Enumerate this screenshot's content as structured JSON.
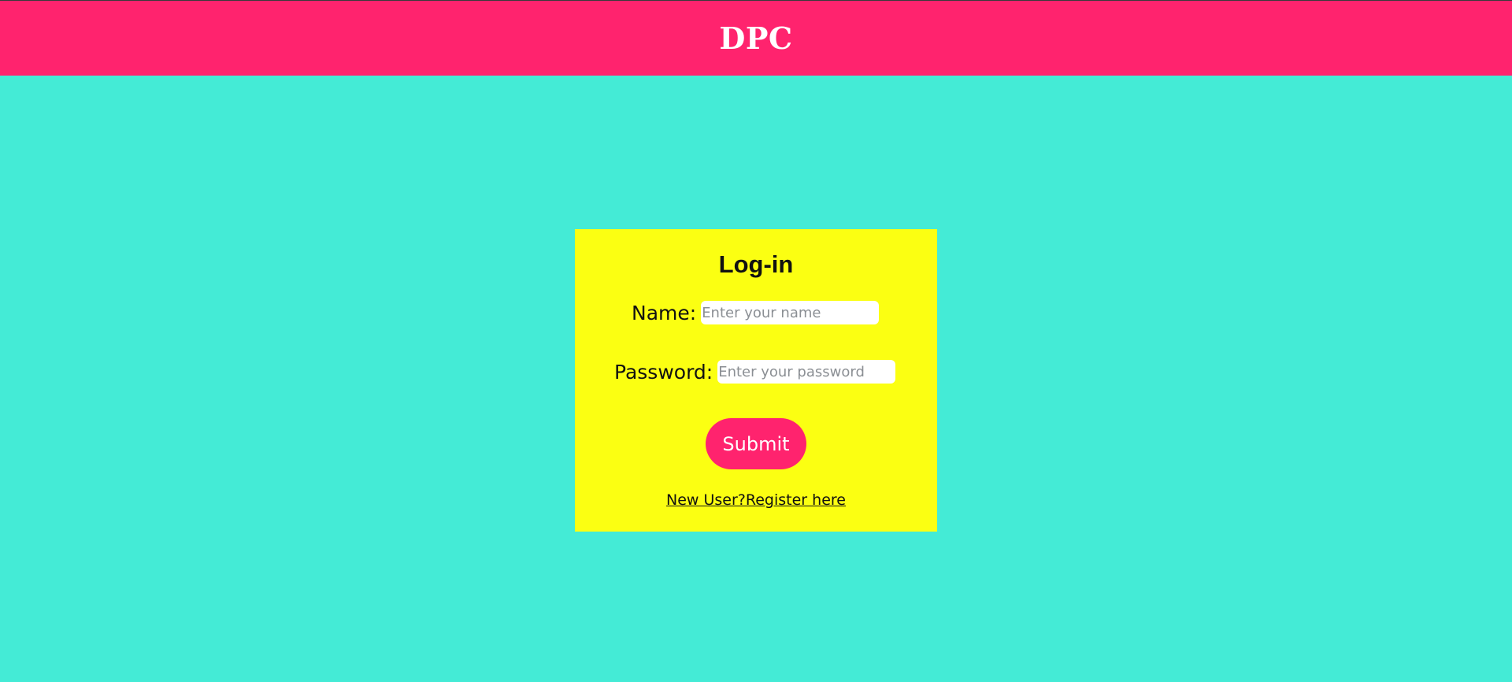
{
  "header": {
    "brand": "DPC",
    "background_color": "#ff236e"
  },
  "page": {
    "background_color": "#44ebd6"
  },
  "login_card": {
    "background_color": "#fbff12",
    "title": "Log-in",
    "name_label": "Name:",
    "name_placeholder": "Enter your name",
    "name_value": "",
    "password_label": "Password:",
    "password_placeholder": "Enter your password",
    "password_value": "",
    "submit_label": "Submit",
    "register_link": "New User?Register here"
  }
}
